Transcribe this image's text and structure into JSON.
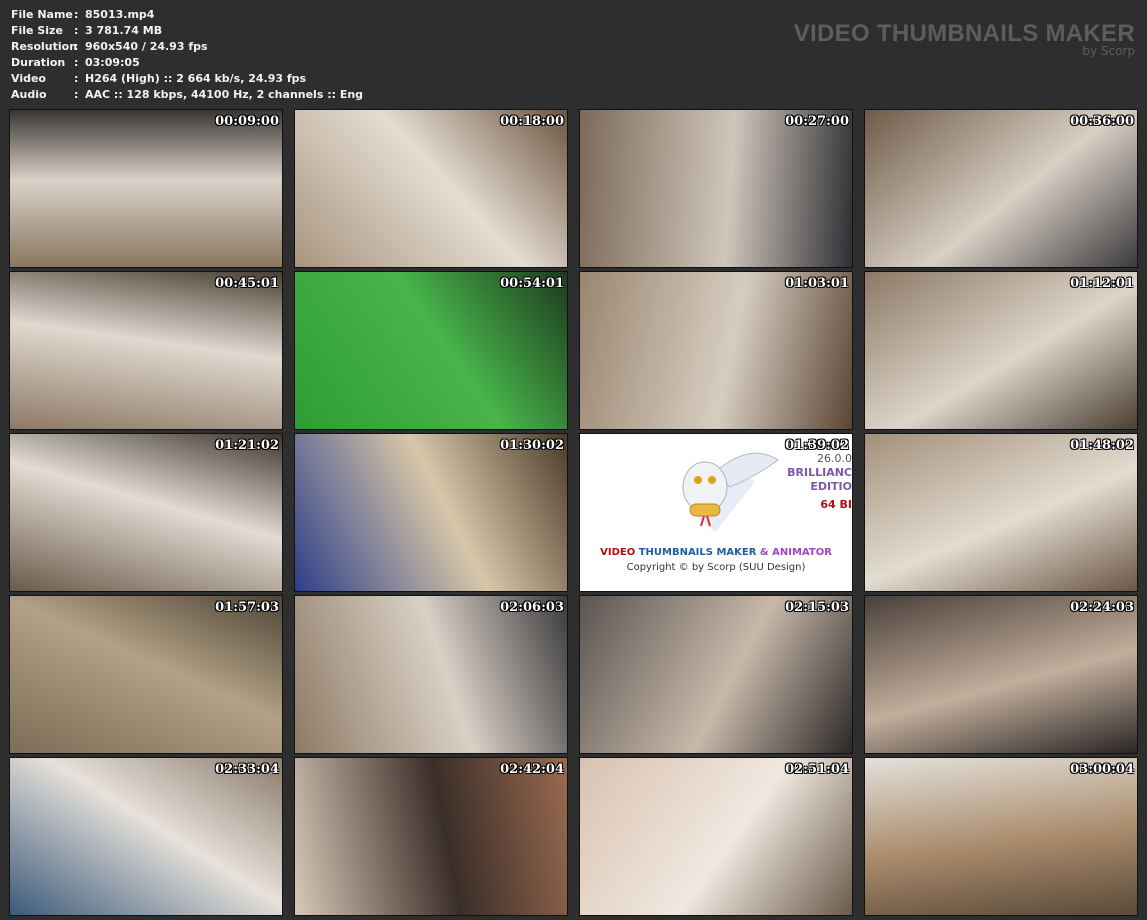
{
  "info": [
    {
      "label": "File Name",
      "value": "85013.mp4"
    },
    {
      "label": "File Size",
      "value": "3 781.74 MB"
    },
    {
      "label": "Resolution",
      "value": "960x540 / 24.93 fps"
    },
    {
      "label": "Duration",
      "value": "03:09:05"
    },
    {
      "label": "Video",
      "value": "H264 (High) :: 2 664 kb/s, 24.93 fps"
    },
    {
      "label": "Audio",
      "value": "AAC :: 128 kbps, 44100 Hz, 2 channels :: Eng"
    }
  ],
  "separator": ":",
  "brand": {
    "title": "VIDEO THUMBNAILS MAKER",
    "subtitle": "by Scorp"
  },
  "logo": {
    "version": "26.0.0",
    "edition_1": "BRILLIANC",
    "edition_2": "EDITIO",
    "bits": "64 BI",
    "title_1": "VIDEO",
    "title_2": "THUMBNAILS MAKER",
    "title_3": "& ANIMATOR",
    "copyright": "Copyright © by Scorp (SUU Design)"
  },
  "thumbnails": [
    {
      "time": "00:09:00",
      "colors": [
        "#8a7560",
        "#d9d2c8",
        "#3a3632"
      ]
    },
    {
      "time": "00:18:00",
      "colors": [
        "#a8957f",
        "#e4ddd2",
        "#6d5440"
      ]
    },
    {
      "time": "00:27:00",
      "colors": [
        "#7c6a58",
        "#cfc6bb",
        "#2f2f34"
      ]
    },
    {
      "time": "00:36:00",
      "colors": [
        "#6e5a48",
        "#d8d0c4",
        "#3c3a3e"
      ]
    },
    {
      "time": "00:45:01",
      "colors": [
        "#8d7966",
        "#e0d9cf",
        "#4a3f35"
      ]
    },
    {
      "time": "00:54:01",
      "colors": [
        "#2f9c35",
        "#48b44a",
        "#1d3a1f"
      ]
    },
    {
      "time": "01:03:01",
      "colors": [
        "#9a8570",
        "#d6cdc0",
        "#5a4535"
      ]
    },
    {
      "time": "01:12:01",
      "colors": [
        "#8c7965",
        "#ddd5ca",
        "#4b3e33"
      ]
    },
    {
      "time": "01:21:02",
      "colors": [
        "#6b5a4a",
        "#e2dcd3",
        "#3d342c"
      ]
    },
    {
      "time": "01:30:02",
      "colors": [
        "#2e3f8a",
        "#d8c7a8",
        "#4a3b2a"
      ]
    },
    {
      "time": "01:39:02",
      "logo": true
    },
    {
      "time": "01:48:02",
      "colors": [
        "#a3907b",
        "#e3dcd1",
        "#6a5645"
      ]
    },
    {
      "time": "01:57:03",
      "colors": [
        "#7d6c56",
        "#b2a186",
        "#4f4435"
      ]
    },
    {
      "time": "02:06:03",
      "colors": [
        "#8e7a65",
        "#d9d1c6",
        "#3b3a3d"
      ]
    },
    {
      "time": "02:15:03",
      "colors": [
        "#5a5550",
        "#c8b8aa",
        "#2b2826"
      ]
    },
    {
      "time": "02:24:03",
      "colors": [
        "#4a403a",
        "#c2ae9c",
        "#2a2624"
      ]
    },
    {
      "time": "02:33:04",
      "colors": [
        "#3c5a7a",
        "#e6e1da",
        "#8a7a6a"
      ]
    },
    {
      "time": "02:42:04",
      "colors": [
        "#d8c8b8",
        "#3a2e28",
        "#9a6a50"
      ]
    },
    {
      "time": "02:51:04",
      "colors": [
        "#d9c2b0",
        "#f0e8e0",
        "#6a5a4a"
      ]
    },
    {
      "time": "03:00:04",
      "colors": [
        "#e4e0da",
        "#a88a6a",
        "#5a4a3a"
      ]
    }
  ]
}
